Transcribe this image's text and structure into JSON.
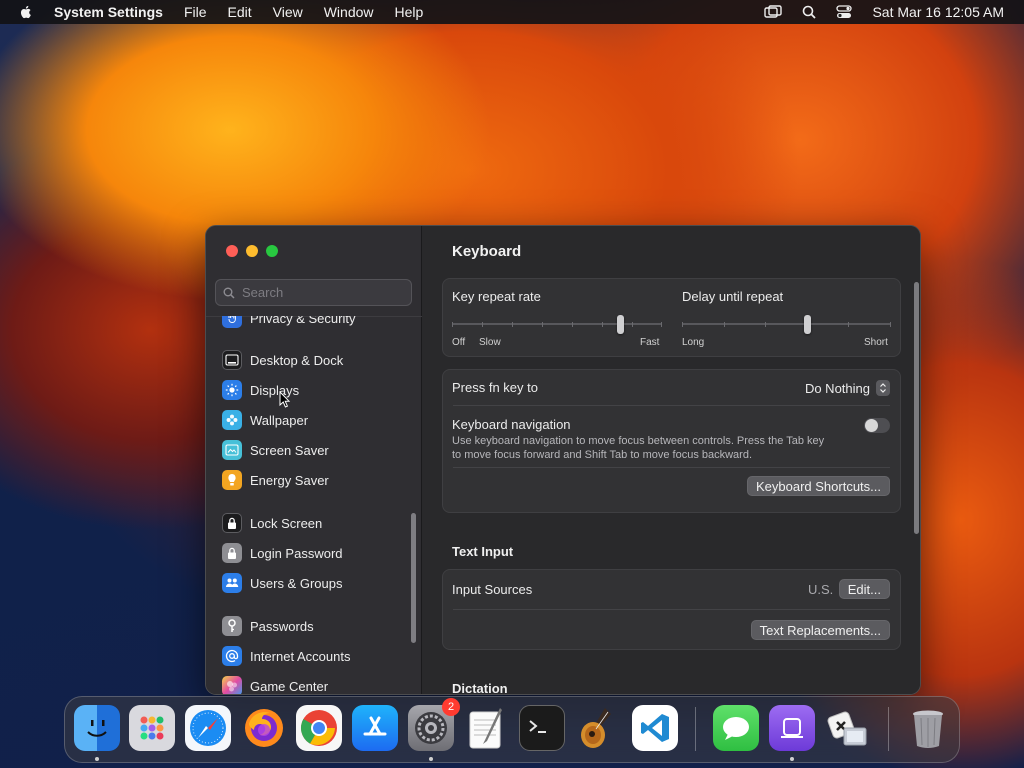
{
  "menubar": {
    "app_name": "System Settings",
    "menus": [
      "File",
      "Edit",
      "View",
      "Window",
      "Help"
    ],
    "clock": "Sat Mar 16  12:05 AM"
  },
  "sidebar": {
    "search_placeholder": "Search",
    "items": [
      {
        "label": "Privacy & Security",
        "icon": "hand-icon",
        "color": "#2f6fde"
      },
      {
        "label": "Desktop & Dock",
        "icon": "dock-icon",
        "color": "#1c1c1e"
      },
      {
        "label": "Displays",
        "icon": "sun-icon",
        "color": "#2c7ee9"
      },
      {
        "label": "Wallpaper",
        "icon": "flower-icon",
        "color": "#3ab0e6"
      },
      {
        "label": "Screen Saver",
        "icon": "screen-saver-icon",
        "color": "#47c0d8"
      },
      {
        "label": "Energy Saver",
        "icon": "battery-icon",
        "color": "#f3a521"
      },
      {
        "label": "Lock Screen",
        "icon": "lock-icon",
        "color": "#1c1c1e"
      },
      {
        "label": "Login Password",
        "icon": "padlock-icon",
        "color": "#8e8e93"
      },
      {
        "label": "Users & Groups",
        "icon": "users-icon",
        "color": "#2c7ee9"
      },
      {
        "label": "Passwords",
        "icon": "key-icon",
        "color": "#8e8e93"
      },
      {
        "label": "Internet Accounts",
        "icon": "at-icon",
        "color": "#2c7ee9"
      },
      {
        "label": "Game Center",
        "icon": "game-center-icon",
        "color": "#e24ba3"
      }
    ]
  },
  "content": {
    "title": "Keyboard",
    "key_repeat": {
      "label": "Key repeat rate",
      "left_min": "Off",
      "left_slow": "Slow",
      "right": "Fast",
      "value_fraction": 0.8
    },
    "delay_repeat": {
      "label": "Delay until repeat",
      "left": "Long",
      "right": "Short",
      "value_fraction": 0.6
    },
    "fn_key": {
      "label": "Press fn key to",
      "value": "Do Nothing"
    },
    "keyboard_nav": {
      "label": "Keyboard navigation",
      "desc1": "Use keyboard navigation to move focus between controls. Press the Tab key",
      "desc2": "to move focus forward and Shift Tab to move focus backward.",
      "enabled": false
    },
    "shortcuts_button": "Keyboard Shortcuts...",
    "text_input": {
      "section": "Text Input",
      "input_sources_label": "Input Sources",
      "input_sources_value": "U.S.",
      "edit_button": "Edit...",
      "replacements_button": "Text Replacements..."
    },
    "dictation_section": "Dictation"
  },
  "dock": {
    "apps": [
      {
        "name": "finder-icon",
        "color": "#3a8ef0"
      },
      {
        "name": "launchpad-icon",
        "color": "#d6d6dc"
      },
      {
        "name": "safari-icon",
        "color": "#eef3fb"
      },
      {
        "name": "firefox-icon",
        "color": "#ff7a12"
      },
      {
        "name": "chrome-icon",
        "color": "#ffffff"
      },
      {
        "name": "app-store-icon",
        "color": "#1f8df6"
      },
      {
        "name": "system-settings-icon",
        "color": "#8f8f95",
        "badge": "2"
      },
      {
        "name": "textedit-icon",
        "color": "#f4f4f4"
      },
      {
        "name": "terminal-icon",
        "color": "#1b1b1b"
      },
      {
        "name": "garageband-icon",
        "color": "#3a2b20"
      },
      {
        "name": "vscode-icon",
        "color": "#ffffff"
      },
      {
        "name": "messages-icon",
        "color": "#3ccf4e"
      },
      {
        "name": "podcast-icon",
        "color": "#8a55e6"
      },
      {
        "name": "migration-assistant-icon",
        "color": "#dfe3ea"
      },
      {
        "name": "trash-icon",
        "color": "#9c9ca2"
      }
    ]
  }
}
